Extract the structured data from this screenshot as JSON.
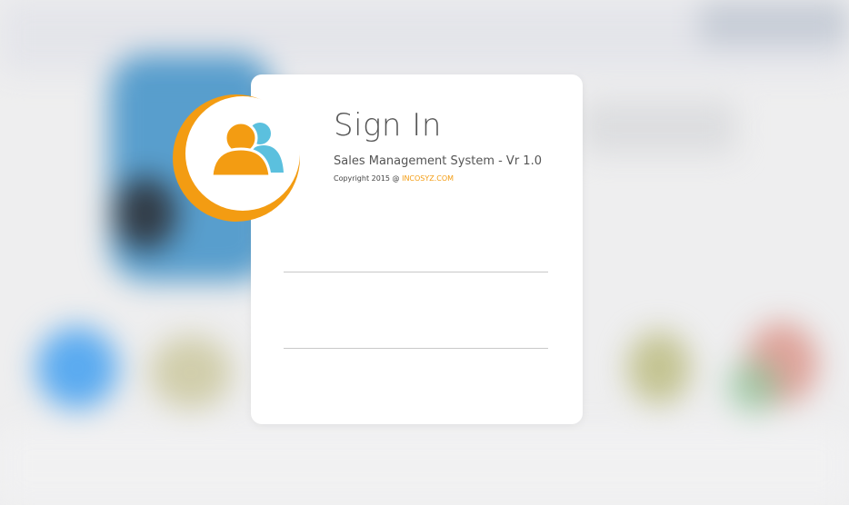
{
  "login": {
    "title": "Sign In",
    "subtitle": "Sales Management System - Vr 1.0",
    "copyright_prefix": "Copyright 2015 @ ",
    "copyright_link": "INCOSYZ.COM",
    "username": {
      "value": "",
      "placeholder": ""
    },
    "password": {
      "value": "",
      "placeholder": ""
    }
  },
  "logo": {
    "icon": "users-icon"
  },
  "colors": {
    "accent_orange": "#f39c12",
    "accent_blue": "#5bc0de",
    "card_bg": "#ffffff",
    "title_text": "#555555"
  }
}
